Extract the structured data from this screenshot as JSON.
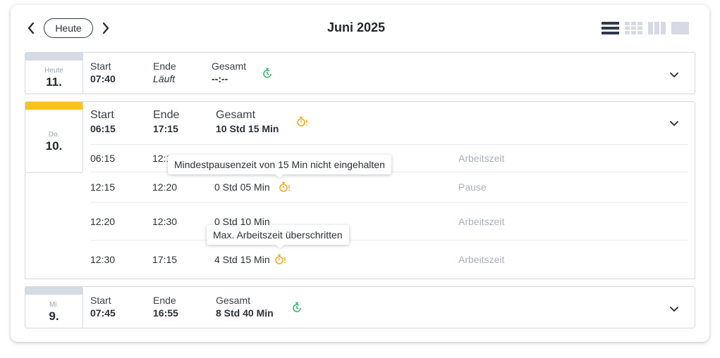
{
  "header": {
    "today_label": "Heute",
    "month_title": "Juni 2025",
    "views": [
      "list-view-icon",
      "grid-view-icon",
      "columns-view-icon",
      "single-view-icon"
    ]
  },
  "labels": {
    "start": "Start",
    "end": "Ende",
    "total": "Gesamt"
  },
  "days": [
    {
      "weekday": "Heute",
      "day": "11.",
      "start": "07:40",
      "end": "Läuft",
      "total": "--:--",
      "status_icon": "running-timer-icon",
      "status_color": "#2fb36a",
      "strip_color": "#d5dae5"
    },
    {
      "weekday": "Do.",
      "day": "10.",
      "start": "06:15",
      "end": "17:15",
      "total": "10 Std 15 Min",
      "status_icon": "timer-warning-icon",
      "status_color": "#f2a81d",
      "strip_color": "#f8c31c",
      "entries": [
        {
          "start": "06:15",
          "end": "12:1",
          "duration": "",
          "type": "Arbeitszeit"
        },
        {
          "start": "12:15",
          "end": "12:20",
          "duration": "0 Std 05 Min",
          "type": "Pause",
          "warning": true
        },
        {
          "start": "12:20",
          "end": "12:30",
          "duration": "0 Std 10 Min",
          "type": "Arbeitszeit"
        },
        {
          "start": "12:30",
          "end": "17:15",
          "duration": "4 Std 15 Min",
          "type": "Arbeitszeit",
          "warning": true
        }
      ]
    },
    {
      "weekday": "Mi.",
      "day": "9.",
      "start": "07:45",
      "end": "16:55",
      "total": "8 Std 40 Min",
      "status_icon": "running-timer-icon",
      "status_color": "#2fb36a",
      "strip_color": "#d5dae5"
    }
  ],
  "tooltips": {
    "pause": "Mindestpausenzeit von 15 Min nicht eingehalten",
    "worktime": "Max. Arbeitszeit überschritten"
  }
}
